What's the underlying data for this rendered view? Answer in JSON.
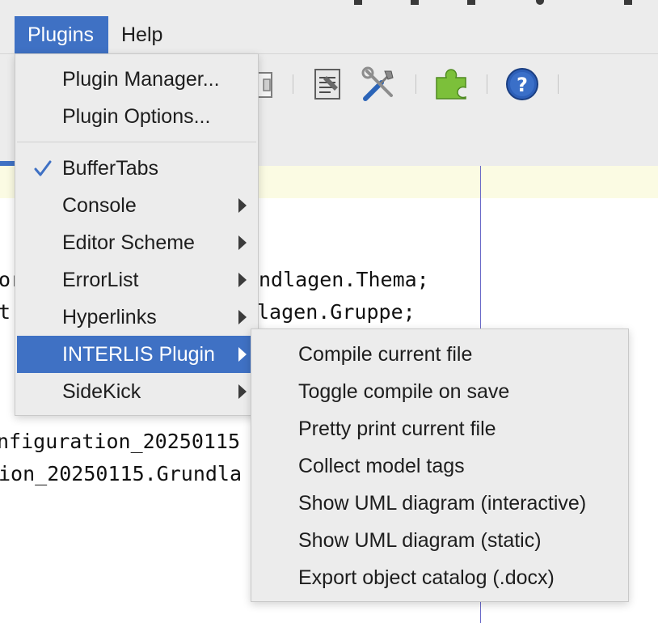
{
  "menubar": {
    "items": [
      {
        "label": "Plugins",
        "active": true
      },
      {
        "label": "Help",
        "active": false
      }
    ]
  },
  "toolbar": {
    "icons": [
      "document-icon",
      "document-edit-icon",
      "tools-icon",
      "puzzle-icon",
      "help-icon"
    ]
  },
  "editor": {
    "lines": [
      "or",
      "ndlagen.Thema;",
      "t",
      "lagen.Gruppe;",
      "nfiguration_20250115",
      "ion_20250115.Grundla"
    ]
  },
  "plugins_menu": {
    "items": [
      {
        "label": "Plugin Manager...",
        "checked": false,
        "submenu": false
      },
      {
        "label": "Plugin Options...",
        "checked": false,
        "submenu": false
      },
      {
        "label": "BufferTabs",
        "checked": true,
        "submenu": false
      },
      {
        "label": "Console",
        "checked": false,
        "submenu": true
      },
      {
        "label": "Editor Scheme",
        "checked": false,
        "submenu": true
      },
      {
        "label": "ErrorList",
        "checked": false,
        "submenu": true
      },
      {
        "label": "Hyperlinks",
        "checked": false,
        "submenu": true
      },
      {
        "label": "INTERLIS Plugin",
        "checked": false,
        "submenu": true,
        "active": true
      },
      {
        "label": "SideKick",
        "checked": false,
        "submenu": true
      }
    ]
  },
  "interlis_submenu": {
    "items": [
      {
        "label": "Compile current file"
      },
      {
        "label": "Toggle compile on save"
      },
      {
        "label": "Pretty print current file"
      },
      {
        "label": "Collect model tags"
      },
      {
        "label": "Show UML diagram (interactive)"
      },
      {
        "label": "Show UML diagram (static)"
      },
      {
        "label": "Export object catalog (.docx)"
      }
    ]
  },
  "colors": {
    "accent": "#3f71c4",
    "menu_bg": "#ececec",
    "current_line": "#fbfbe3",
    "margin_line": "#6a6ac8"
  }
}
